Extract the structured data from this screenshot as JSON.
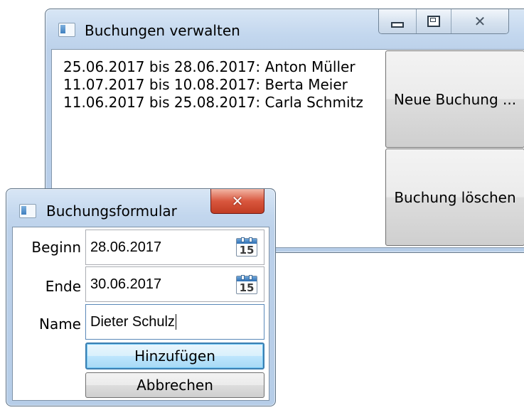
{
  "main_window": {
    "title": "Buchungen verwalten",
    "bookings": [
      "25.06.2017 bis 28.06.2017: Anton Müller",
      "11.07.2017 bis 10.08.2017: Berta Meier",
      "11.06.2017 bis 25.08.2017: Carla Schmitz"
    ],
    "new_booking_label": "Neue Buchung ...",
    "delete_booking_label": "Buchung löschen"
  },
  "dialog": {
    "title": "Buchungsformular",
    "begin_label": "Beginn",
    "begin_value": "28.06.2017",
    "end_label": "Ende",
    "end_value": "30.06.2017",
    "name_label": "Name",
    "name_value": "Dieter Schulz",
    "add_label": "Hinzufügen",
    "cancel_label": "Abbrechen",
    "calendar_day": "15"
  },
  "icons": {
    "minimize": "minimize-icon",
    "maximize": "maximize-icon",
    "close": "close-icon",
    "calendar": "calendar-icon",
    "window": "window-icon"
  },
  "colors": {
    "frame": "#bcd1ea",
    "close_red": "#d9573e",
    "default_button": "#bee6fd"
  }
}
